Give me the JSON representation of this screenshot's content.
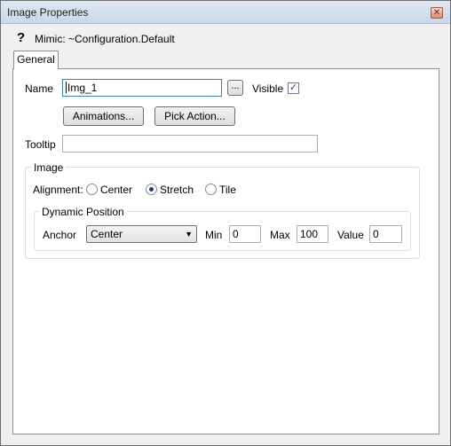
{
  "window": {
    "title": "Image Properties",
    "close_glyph": "✕"
  },
  "mimic": {
    "help_glyph": "?",
    "text": "Mimic: ~Configuration.Default"
  },
  "tabs": [
    {
      "label": "General"
    }
  ],
  "general": {
    "name_label": "Name",
    "name_value": "Img_1",
    "browse_label": "...",
    "visible_label": "Visible",
    "visible_checked": true,
    "animations_label": "Animations...",
    "pick_action_label": "Pick Action...",
    "tooltip_label": "Tooltip",
    "tooltip_value": ""
  },
  "image_group": {
    "title": "Image",
    "alignment_label": "Alignment:",
    "alignment_options": [
      {
        "label": "Center",
        "checked": false
      },
      {
        "label": "Stretch",
        "checked": true
      },
      {
        "label": "Tile",
        "checked": false
      }
    ],
    "dynamic_position": {
      "title": "Dynamic Position",
      "anchor_label": "Anchor",
      "anchor_value": "Center",
      "min_label": "Min",
      "min_value": "0",
      "max_label": "Max",
      "max_value": "100",
      "value_label": "Value",
      "value_value": "0"
    }
  },
  "icons": {
    "help": "help-icon",
    "close": "close-icon",
    "dropdown": "chevron-down-icon",
    "check": "checkmark-icon"
  }
}
